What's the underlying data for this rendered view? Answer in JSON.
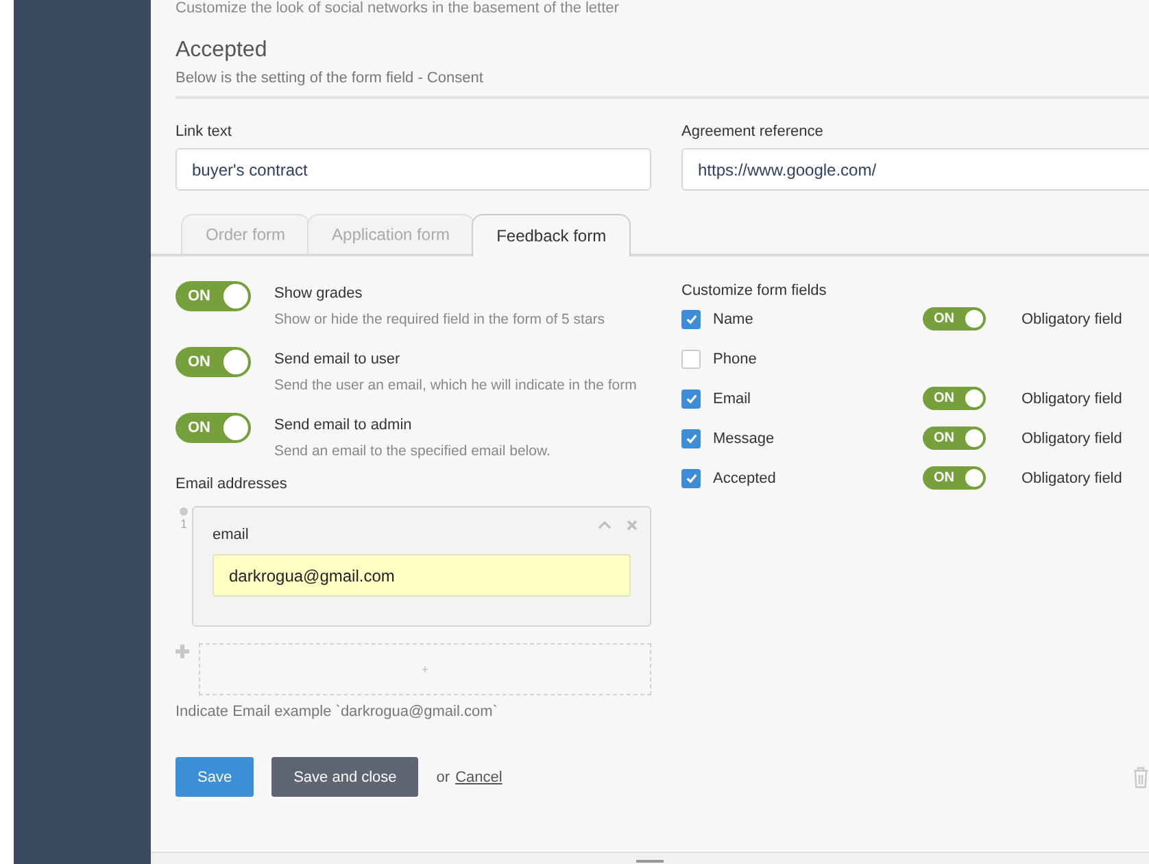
{
  "top_note": "Customize the look of social networks in the basement of the letter",
  "section": {
    "title": "Accepted",
    "subtitle": "Below is the setting of the form field - Consent"
  },
  "fields": [
    {
      "label": "Link text",
      "value": "buyer's contract"
    },
    {
      "label": "Agreement reference",
      "value": "https://www.google.com/"
    }
  ],
  "tabs": [
    {
      "label": "Order form",
      "selected": false
    },
    {
      "label": "Application form",
      "selected": false
    },
    {
      "label": "Feedback form",
      "selected": true
    }
  ],
  "settings": [
    {
      "switch": "ON",
      "on": true,
      "title": "Show grades",
      "description": "Show or hide the required field in the form of 5 stars"
    },
    {
      "switch": "ON",
      "on": true,
      "title": "Send email to user",
      "description": "Send the user an email, which he will indicate in the form"
    },
    {
      "switch": "ON",
      "on": true,
      "title": "Send email to admin",
      "description": "Send an email to the specified email below."
    }
  ],
  "email_addresses": {
    "label": "Email addresses",
    "items": [
      {
        "index": "1",
        "field_label": "email",
        "value": "darkrogua@gmail.com"
      }
    ],
    "add_label": "+",
    "hint": "Indicate Email example `darkrogua@gmail.com`"
  },
  "form_fields": {
    "title": "Customize form fields",
    "items": [
      {
        "name": "Name",
        "checked": true,
        "switch": "ON",
        "on": true,
        "required_label": "Obligatory field"
      },
      {
        "name": "Phone",
        "checked": false
      },
      {
        "name": "Email",
        "checked": true,
        "switch": "ON",
        "on": true,
        "required_label": "Obligatory field"
      },
      {
        "name": "Message",
        "checked": true,
        "switch": "ON",
        "on": true,
        "required_label": "Obligatory field"
      },
      {
        "name": "Accepted",
        "checked": true,
        "switch": "ON",
        "on": true,
        "required_label": "Obligatory field"
      }
    ]
  },
  "actions": {
    "save": "Save",
    "save_close": "Save and close",
    "or": "or",
    "cancel": "Cancel"
  }
}
